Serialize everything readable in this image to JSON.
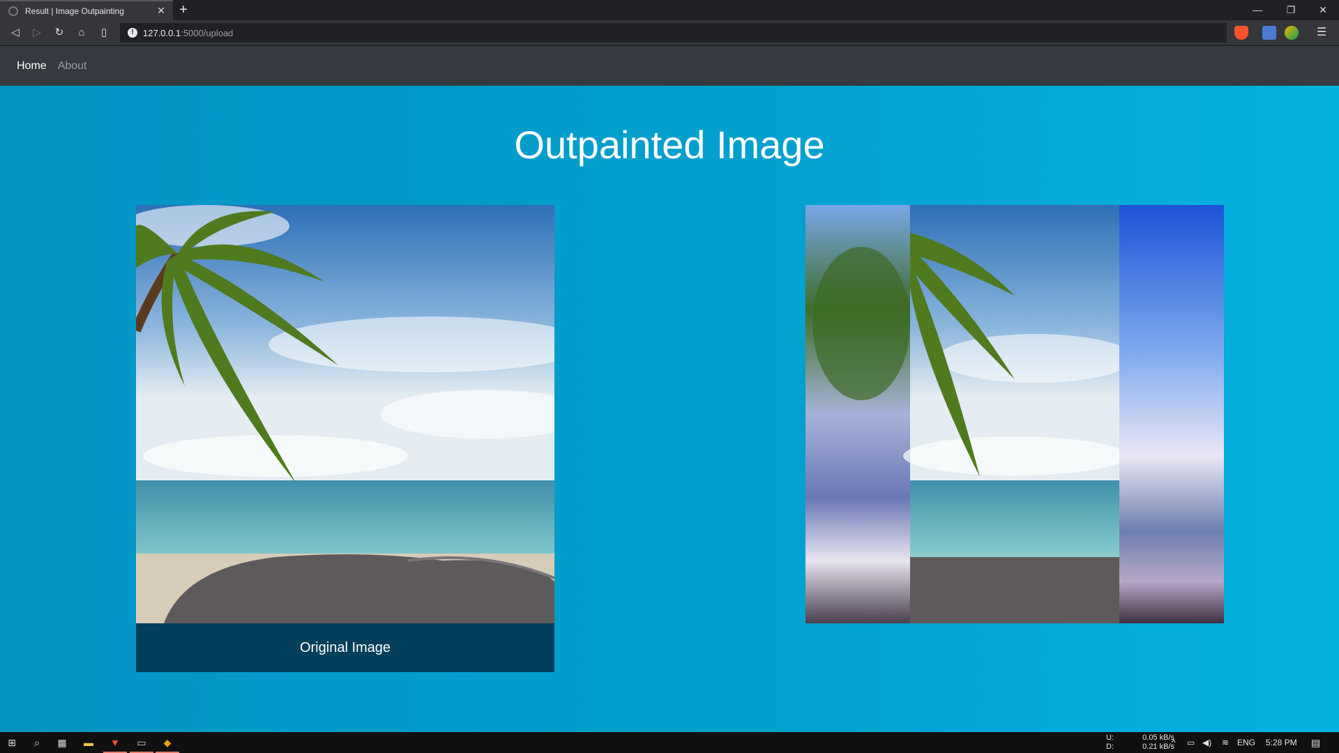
{
  "browser": {
    "tab_title": "Result | Image Outpainting",
    "url_host": "127.0.0.1",
    "url_path": ":5000/upload"
  },
  "navbar": {
    "home": "Home",
    "about": "About"
  },
  "main": {
    "heading": "Outpainted Image",
    "left_caption": "Original Image"
  },
  "taskbar": {
    "net_up_label": "U:",
    "net_down_label": "D:",
    "net_up": "0.05 kB/s",
    "net_down": "0.21 kB/s",
    "language": "ENG",
    "time": "5:28 PM"
  },
  "colors": {
    "page_bg_start": "#0494c4",
    "page_bg_end": "#04b2e0",
    "navbar_bg": "#343a40",
    "caption_bg": "#023f5c"
  }
}
